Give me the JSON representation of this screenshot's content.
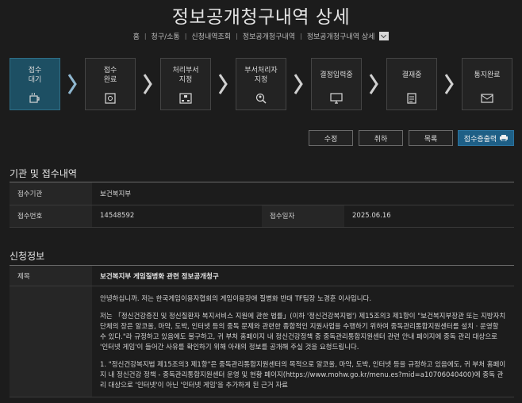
{
  "page": {
    "title": "정보공개청구내역 상세"
  },
  "breadcrumb": [
    "홈",
    "청구/소통",
    "신청내역조회",
    "정보공개청구내역",
    "정보공개청구내역 상세"
  ],
  "steps": [
    {
      "label": "접수\n대기",
      "icon": "cup-icon",
      "active": true
    },
    {
      "label": "접수\n완료",
      "icon": "document-check-icon",
      "active": false
    },
    {
      "label": "처리부서\n지정",
      "icon": "org-chart-icon",
      "active": false
    },
    {
      "label": "부서처리자\n지정",
      "icon": "person-search-icon",
      "active": false
    },
    {
      "label": "결정입력중",
      "icon": "monitor-icon",
      "active": false
    },
    {
      "label": "결재중",
      "icon": "clipboard-icon",
      "active": false
    },
    {
      "label": "통지완료",
      "icon": "mail-icon",
      "active": false
    }
  ],
  "actions": {
    "edit": "수정",
    "withdraw": "취하",
    "list": "목록",
    "print": "접수증출력"
  },
  "agency": {
    "section_title": "기관 및 접수내역",
    "agency_label": "접수기관",
    "agency_value": "보건복지부",
    "number_label": "접수번호",
    "number_value": "14548592",
    "date_label": "접수일자",
    "date_value": "2025.06.16"
  },
  "request": {
    "section_title": "신청정보",
    "title_label": "제목",
    "title_value": "보건복지부 게임질병화 관련 정보공개청구",
    "content_label": "",
    "paragraphs": [
      "안녕하십니까. 저는 한국게임이용자협회의 게임이용장애 질병화 반대 TF팀장 노경훈 이사입니다.",
      "저는 「정신건강증진 및 정신질환자 복지서비스 지원에 관한 법률」(이하 '정신건강복지법') 제15조의3 제1항이 \"보건복지부장관 또는 지방자치단체의 장은 알코올, 마약, 도박, 인터넷 등의 중독 문제와 관련한 종합적인 지원사업을 수행하기 위하여 중독관리통합지원센터를 설치 · 운영할 수 있다.\"라 규정하고 있음에도 불구하고, 귀 부처 홈페이지 내 정신건강정책 중 중독관리통합지원센터 관련 안내 페이지에 중독 관리 대상으로 '인터넷 게임'이 들어간 사유를 확인하기 위해 아래의 정보를 공개해 주실 것을 요청드립니다.",
      "1. \"정신건강복지법 제15조의3 제1항\"은 중독관리통합지원센터의 목적으로 알코올, 마약, 도박, 인터넷 등을 규정하고 있음에도, 귀 부처 홈페이지 내 정신건강 정책 - 중독관리통합지원센터 운영 및 현황 페이지(https://www.mohw.go.kr/menu.es?mid=a10706040400)에 중독 관리 대상으로 '인터넷'이 아닌 '인터넷 게임'을 추가하게 된 근거 자료"
    ]
  }
}
